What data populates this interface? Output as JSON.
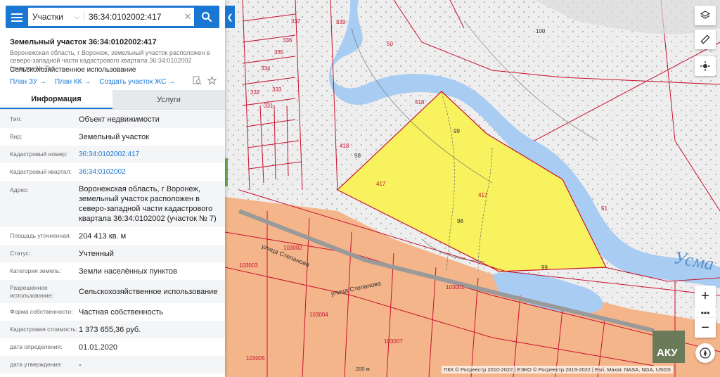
{
  "search": {
    "type": "Участки",
    "query": "36:34:0102002:417"
  },
  "object": {
    "title": "Земельный участок 36:34:0102002:417",
    "address": "Воронежская область, г Воронеж, земельный участок расположен в северо-западной части кадастрового квартала 36:34:0102002 (участок № 7)",
    "use": "Сельскохозяйственное использование",
    "links": [
      "План ЗУ",
      "План КК",
      "Создать участок ЖС"
    ]
  },
  "tabs": {
    "info": "Информация",
    "services": "Услуги"
  },
  "rows": [
    {
      "k": "Тип:",
      "v": "Объект недвижимости"
    },
    {
      "k": "Вид:",
      "v": "Земельный участок"
    },
    {
      "k": "Кадастровый номер:",
      "v": "36:34:0102002:417"
    },
    {
      "k": "Кадастровый квартал:",
      "v": "36:34:0102002"
    },
    {
      "k": "Адрес:",
      "v": "Воронежская область, г Воронеж, земельный участок расположен в северо-западной части кадастрового квартала 36:34:0102002 (участок № 7)"
    },
    {
      "k": "Площадь уточненная:",
      "v": "204 413 кв. м"
    },
    {
      "k": "Статус:",
      "v": "Учтенный"
    },
    {
      "k": "Категория земель:",
      "v": "Земли населённых пунктов"
    },
    {
      "k": "Разрешенное использование:",
      "v": "Сельскохозяйственное использование"
    },
    {
      "k": "Форма собственности:",
      "v": "Частная собственность"
    },
    {
      "k": "Кадастровая стоимость:",
      "v": "1 373 655,36 руб."
    },
    {
      "k": "дата определения:",
      "v": "01.01.2020"
    },
    {
      "k": "дата утверждения:",
      "v": "-"
    }
  ],
  "map": {
    "parcel_labels": [
      "417",
      "418",
      "418",
      "339",
      "337",
      "336",
      "335",
      "334",
      "333",
      "332",
      "331",
      "50",
      "51",
      "98",
      "98",
      "99",
      "99",
      "100"
    ],
    "quarter_labels": [
      "103002",
      "103003",
      "103004",
      "103001",
      "103007",
      "103005"
    ],
    "streets": [
      "улица Степанова",
      "улица Степанова"
    ],
    "river": "Усма",
    "scale": "200 м",
    "attribution": "ПКК © Росреестр 2010-2022 | ЕЭКО © Росреестр 2019-2022 | Esri, Maxar, NASA, NGA, USGS",
    "watermark": "АКУ",
    "colors": {
      "parcel_fill": "#f7f25e",
      "urban": "#f4b58a",
      "boundary": "#c8102e",
      "river": "#a9cdf2",
      "accent": "#1976d2"
    }
  }
}
